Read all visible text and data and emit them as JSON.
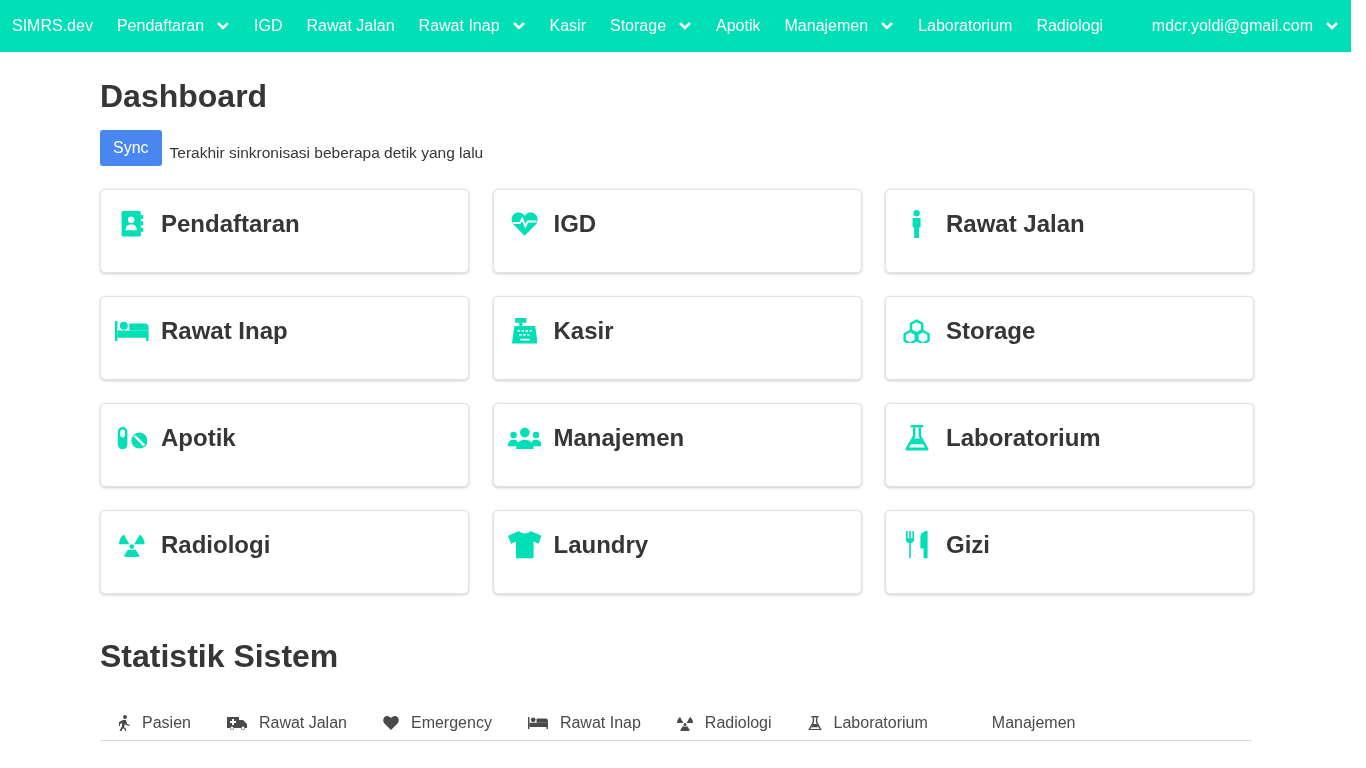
{
  "navbar": {
    "brand": "SIMRS.dev",
    "items": [
      {
        "label": "Pendaftaran",
        "dropdown": true
      },
      {
        "label": "IGD",
        "dropdown": false
      },
      {
        "label": "Rawat Jalan",
        "dropdown": false
      },
      {
        "label": "Rawat Inap",
        "dropdown": true
      },
      {
        "label": "Kasir",
        "dropdown": false
      },
      {
        "label": "Storage",
        "dropdown": true
      },
      {
        "label": "Apotik",
        "dropdown": false
      },
      {
        "label": "Manajemen",
        "dropdown": true
      },
      {
        "label": "Laboratorium",
        "dropdown": false
      },
      {
        "label": "Radiologi",
        "dropdown": false
      }
    ],
    "user": {
      "label": "mdcr.yoldi@gmail.com",
      "dropdown": true
    }
  },
  "heading": "Dashboard",
  "sync": {
    "button": "Sync",
    "status": "Terakhir sinkronisasi beberapa detik yang lalu"
  },
  "modules": [
    {
      "title": "Pendaftaran"
    },
    {
      "title": "IGD"
    },
    {
      "title": "Rawat Jalan"
    },
    {
      "title": "Rawat Inap"
    },
    {
      "title": "Kasir"
    },
    {
      "title": "Storage"
    },
    {
      "title": "Apotik"
    },
    {
      "title": "Manajemen"
    },
    {
      "title": "Laboratorium"
    },
    {
      "title": "Radiologi"
    },
    {
      "title": "Laundry"
    },
    {
      "title": "Gizi"
    }
  ],
  "statistics": {
    "heading": "Statistik Sistem",
    "tabs": [
      {
        "label": "Pasien"
      },
      {
        "label": "Rawat Jalan"
      },
      {
        "label": "Emergency"
      },
      {
        "label": "Rawat Inap"
      },
      {
        "label": "Radiologi"
      },
      {
        "label": "Laboratorium"
      },
      {
        "label": "Manajemen"
      }
    ]
  }
}
